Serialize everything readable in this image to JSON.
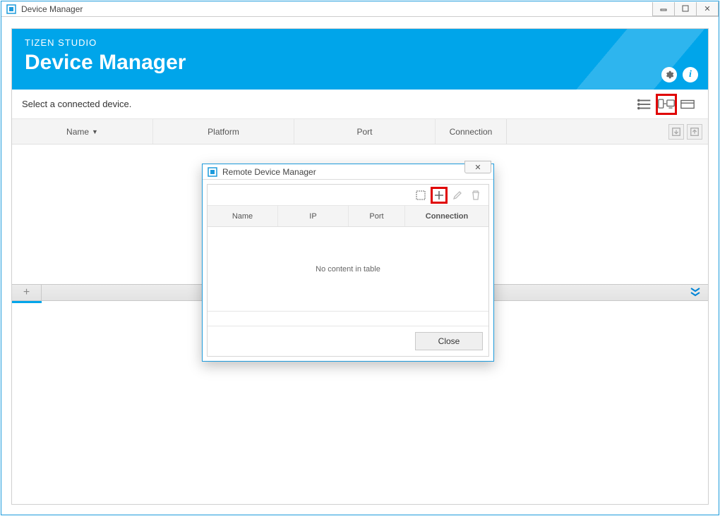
{
  "window": {
    "title": "Device Manager"
  },
  "hero": {
    "subtitle": "TIZEN STUDIO",
    "title": "Device Manager"
  },
  "toolbar": {
    "prompt": "Select a connected device."
  },
  "main_table": {
    "columns": {
      "name": "Name",
      "platform": "Platform",
      "port": "Port",
      "connection": "Connection"
    }
  },
  "dialog": {
    "title": "Remote Device Manager",
    "columns": {
      "name": "Name",
      "ip": "IP",
      "port": "Port",
      "connection": "Connection"
    },
    "empty": "No content in table",
    "close": "Close"
  }
}
